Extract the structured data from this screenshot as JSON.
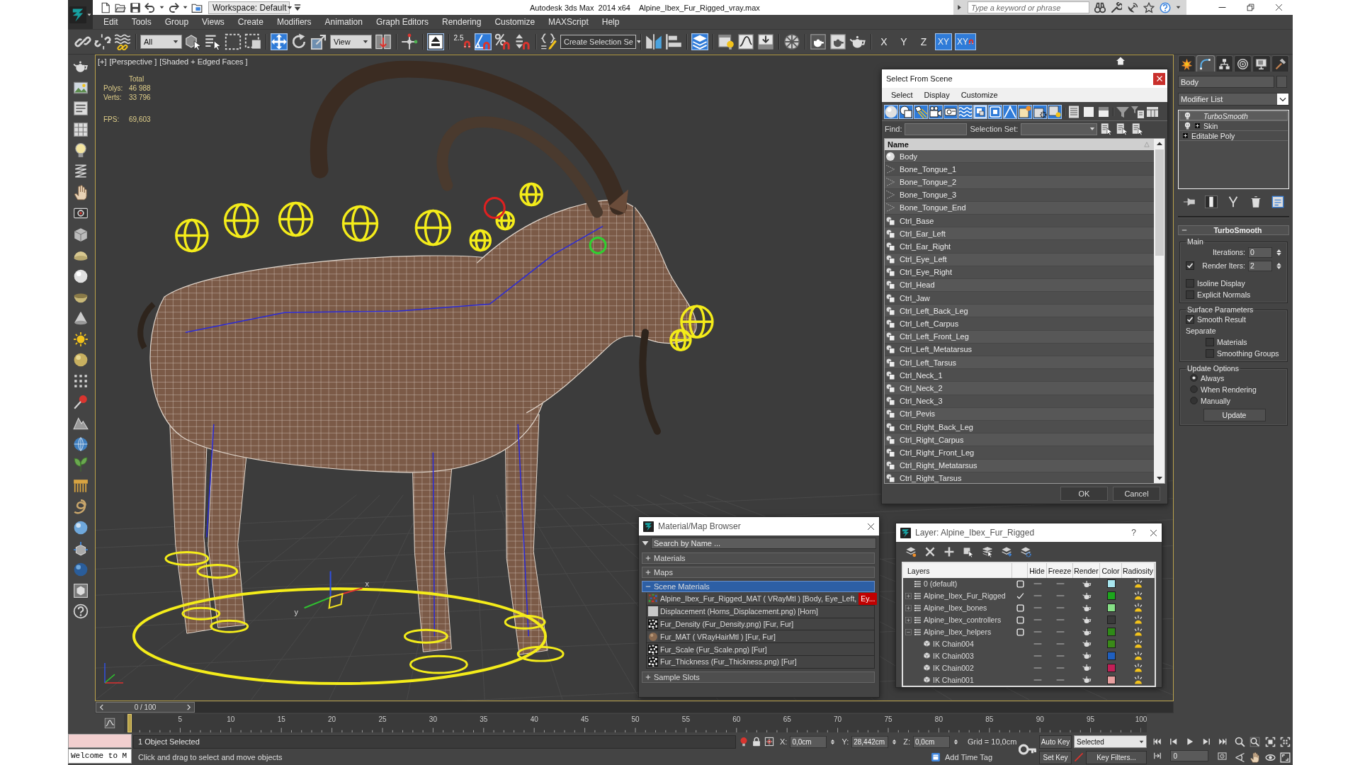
{
  "title_bar": {
    "workspace": "Workspace: Default",
    "app_name": "Autodesk 3ds Max  2014 x64",
    "file_name": "Alpine_Ibex_Fur_Rigged_vray.max",
    "search": {
      "placeholder": "Type a keyword or phrase"
    }
  },
  "menu": [
    "Edit",
    "Tools",
    "Group",
    "Views",
    "Create",
    "Modifiers",
    "Animation",
    "Graph Editors",
    "Rendering",
    "Customize",
    "MAXScript",
    "Help"
  ],
  "main_toolbar": [
    [
      {
        "kind": "icon",
        "selected": false
      },
      {
        "kind": "icon",
        "selected": false
      },
      {
        "kind": "icon",
        "selected": false
      }
    ],
    [
      {
        "kind": "dropdown",
        "value": "All"
      },
      {
        "kind": "icon",
        "selected": false
      },
      {
        "kind": "icon",
        "selected": false
      },
      {
        "kind": "icon",
        "selected": false
      },
      {
        "kind": "icon",
        "selected": false
      }
    ],
    [
      {
        "kind": "icon",
        "selected": true
      },
      {
        "kind": "icon",
        "selected": false
      },
      {
        "kind": "icon",
        "selected": false
      },
      {
        "kind": "dropdown",
        "value": "View"
      },
      {
        "kind": "icon",
        "selected": false
      }
    ],
    [
      {
        "kind": "icon",
        "selected": false
      }
    ],
    [
      {
        "kind": "icon",
        "selected": true
      }
    ],
    [
      {
        "kind": "snap",
        "label": "2.5",
        "selected": false
      },
      {
        "kind": "icon",
        "selected": true
      },
      {
        "kind": "icon",
        "selected": false
      },
      {
        "kind": "icon",
        "selected": false
      }
    ],
    [
      {
        "kind": "icon",
        "selected": false
      },
      {
        "kind": "combo",
        "value": "Create Selection Se"
      }
    ],
    [
      {
        "kind": "icon",
        "selected": false
      },
      {
        "kind": "icon",
        "selected": false
      }
    ],
    [
      {
        "kind": "icon",
        "selected": true
      }
    ],
    [
      {
        "kind": "icon",
        "selected": false
      },
      {
        "kind": "icon",
        "selected": false
      },
      {
        "kind": "icon",
        "selected": false
      }
    ],
    [
      {
        "kind": "icon",
        "selected": false
      }
    ],
    [
      {
        "kind": "icon",
        "selected": false
      },
      {
        "kind": "icon",
        "selected": false
      },
      {
        "kind": "icon",
        "selected": false
      }
    ],
    [
      {
        "kind": "axis",
        "label": "X",
        "selected": false
      },
      {
        "kind": "axis",
        "label": "Y",
        "selected": false
      },
      {
        "kind": "axis",
        "label": "Z",
        "selected": false
      },
      {
        "kind": "axis",
        "label": "XY",
        "selected": true
      },
      {
        "kind": "axis_snap",
        "label": "XY",
        "selected": true
      }
    ]
  ],
  "viewport": {
    "labels": [
      "[+]",
      "[Perspective ]",
      "[Shaded + Edged Faces ]"
    ],
    "stats": {
      "heading": "Total",
      "rows": [
        {
          "label": "Polys:",
          "value": "46 988"
        },
        {
          "label": "Verts:",
          "value": "33 796"
        }
      ],
      "fps": {
        "label": "FPS:",
        "value": "69,603"
      }
    },
    "gizmo_labels": [
      "x",
      "y"
    ]
  },
  "select_from_scene": {
    "title": "Select From Scene",
    "menu": [
      "Select",
      "Display",
      "Customize"
    ],
    "filters": [
      {
        "selected": true
      },
      {
        "selected": true
      },
      {
        "selected": true
      },
      {
        "selected": true
      },
      {
        "selected": true
      },
      {
        "selected": true
      },
      {
        "selected": true
      },
      {
        "selected": true
      },
      {
        "selected": true
      },
      {
        "selected": true
      },
      {
        "selected": true
      },
      {
        "selected": true
      }
    ],
    "find": {
      "label": "Find:"
    },
    "selection_set": {
      "label": "Selection Set:"
    },
    "column": "Name",
    "rows": [
      {
        "name": "Body",
        "kind": "geometry"
      },
      {
        "name": "Bone_Tongue_1",
        "kind": "bone"
      },
      {
        "name": "Bone_Tongue_2",
        "kind": "bone"
      },
      {
        "name": "Bone_Tongue_3",
        "kind": "bone"
      },
      {
        "name": "Bone_Tongue_End",
        "kind": "bone"
      },
      {
        "name": "Ctrl_Base",
        "kind": "helper"
      },
      {
        "name": "Ctrl_Ear_Left",
        "kind": "helper"
      },
      {
        "name": "Ctrl_Ear_Right",
        "kind": "helper"
      },
      {
        "name": "Ctrl_Eye_Left",
        "kind": "helper"
      },
      {
        "name": "Ctrl_Eye_Right",
        "kind": "helper"
      },
      {
        "name": "Ctrl_Head",
        "kind": "helper"
      },
      {
        "name": "Ctrl_Jaw",
        "kind": "helper"
      },
      {
        "name": "Ctrl_Left_Back_Leg",
        "kind": "helper"
      },
      {
        "name": "Ctrl_Left_Carpus",
        "kind": "helper"
      },
      {
        "name": "Ctrl_Left_Front_Leg",
        "kind": "helper"
      },
      {
        "name": "Ctrl_Left_Metatarsus",
        "kind": "helper"
      },
      {
        "name": "Ctrl_Left_Tarsus",
        "kind": "helper"
      },
      {
        "name": "Ctrl_Neck_1",
        "kind": "helper"
      },
      {
        "name": "Ctrl_Neck_2",
        "kind": "helper"
      },
      {
        "name": "Ctrl_Neck_3",
        "kind": "helper"
      },
      {
        "name": "Ctrl_Pevis",
        "kind": "helper"
      },
      {
        "name": "Ctrl_Right_Back_Leg",
        "kind": "helper"
      },
      {
        "name": "Ctrl_Right_Carpus",
        "kind": "helper"
      },
      {
        "name": "Ctrl_Right_Front_Leg",
        "kind": "helper"
      },
      {
        "name": "Ctrl_Right_Metatarsus",
        "kind": "helper"
      },
      {
        "name": "Ctrl_Right_Tarsus",
        "kind": "helper"
      }
    ],
    "buttons": [
      "OK",
      "Cancel"
    ]
  },
  "material_browser": {
    "title": "Material/Map Browser",
    "search": {
      "placeholder": "Search by Name ..."
    },
    "groups": [
      {
        "label": "Materials",
        "expanded": false,
        "selected": false
      },
      {
        "label": "Maps",
        "expanded": false,
        "selected": false
      },
      {
        "label": "Scene Materials",
        "expanded": true,
        "selected": true,
        "items": [
          {
            "kind": "vray_material",
            "label": "Alpine_Ibex_Fur_Rigged_MAT ( VRayMtl ) [Body, Eye_Left,",
            "overflow": "Ey..."
          },
          {
            "kind": "grey_map",
            "label": "Displacement (Horns_Displacement.png) [Horn]"
          },
          {
            "kind": "noise_map",
            "label": "Fur_Density (Fur_Density.png) [Fur, Fur]"
          },
          {
            "kind": "hair_material",
            "label": "Fur_MAT ( VRayHairMtl ) [Fur, Fur]"
          },
          {
            "kind": "noise_map",
            "label": "Fur_Scale (Fur_Scale.png) [Fur]"
          },
          {
            "kind": "noise_map",
            "label": "Fur_Thickness (Fur_Thickness.png) [Fur]"
          }
        ]
      },
      {
        "label": "Sample Slots",
        "expanded": false,
        "selected": false
      }
    ]
  },
  "layer_dialog": {
    "title": "Layer: Alpine_Ibex_Fur_Rigged",
    "help": "?",
    "columns": [
      "Layers",
      "Hide",
      "Freeze",
      "Render",
      "Color",
      "Radiosity"
    ],
    "layers": [
      {
        "name": "0 (default)",
        "expandable": false,
        "expanded": false,
        "current": false,
        "hidden": false,
        "frozen": false,
        "renderable": true,
        "radiosity": true,
        "color": "#a8e6ef"
      },
      {
        "name": "Alpine_Ibex_Fur_Rigged",
        "expandable": true,
        "expanded": false,
        "current": true,
        "hidden": false,
        "frozen": false,
        "renderable": true,
        "radiosity": true,
        "color": "#1da61d"
      },
      {
        "name": "Alpine_Ibex_bones",
        "expandable": true,
        "expanded": false,
        "current": false,
        "hidden": false,
        "frozen": false,
        "renderable": true,
        "radiosity": true,
        "color": "#86e086"
      },
      {
        "name": "Alpine_Ibex_controllers",
        "expandable": true,
        "expanded": false,
        "current": false,
        "hidden": false,
        "frozen": false,
        "renderable": true,
        "radiosity": true,
        "color": "#3a3a3a"
      },
      {
        "name": "Alpine_Ibex_helpers",
        "expandable": true,
        "expanded": true,
        "current": false,
        "hidden": false,
        "frozen": false,
        "renderable": true,
        "radiosity": true,
        "color": "#2f8a17",
        "children": [
          {
            "name": "IK Chain004",
            "hidden": false,
            "frozen": false,
            "renderable": true,
            "radiosity": true,
            "color": "#3a8a18"
          },
          {
            "name": "IK Chain003",
            "hidden": false,
            "frozen": false,
            "renderable": true,
            "radiosity": true,
            "color": "#1f5fbf"
          },
          {
            "name": "IK Chain002",
            "hidden": false,
            "frozen": false,
            "renderable": true,
            "radiosity": true,
            "color": "#c21f57"
          },
          {
            "name": "IK Chain001",
            "hidden": false,
            "frozen": false,
            "renderable": true,
            "radiosity": true,
            "color": "#e8a0a0"
          }
        ]
      }
    ]
  },
  "command_panel": {
    "tabs": [
      {
        "selected": false
      },
      {
        "selected": true
      },
      {
        "selected": false
      },
      {
        "selected": false
      },
      {
        "selected": false
      },
      {
        "selected": false
      }
    ],
    "object_name": "Body",
    "modifier_list": "Modifier List",
    "stack": [
      {
        "label": "TurboSmooth",
        "kind": "modifier",
        "expandable": false,
        "viewport_off": true,
        "selected": true
      },
      {
        "label": "Skin",
        "kind": "modifier",
        "expandable": true,
        "viewport_off": false,
        "selected": false
      },
      {
        "label": "Editable Poly",
        "kind": "object",
        "expandable": true,
        "viewport_off": false,
        "selected": false
      }
    ],
    "stack_tools": [
      {
        "selected": false
      },
      {
        "selected": true
      },
      {
        "selected": false
      },
      {
        "selected": false
      },
      {
        "selected": false
      }
    ],
    "rollout": {
      "title": "TurboSmooth",
      "expanded": true,
      "groups": [
        {
          "title": "Main",
          "controls": [
            {
              "kind": "spinner",
              "label": "Iterations:",
              "value": "0"
            },
            {
              "kind": "check_spinner",
              "label": "Render Iters:",
              "value": "2",
              "checked": true
            },
            {
              "kind": "checkbox",
              "label": "Isoline Display",
              "checked": false
            },
            {
              "kind": "checkbox",
              "label": "Explicit Normals",
              "checked": false
            }
          ]
        },
        {
          "title": "Surface Parameters",
          "controls": [
            {
              "kind": "checkbox",
              "label": "Smooth Result",
              "checked": true
            },
            {
              "kind": "label",
              "label": "Separate",
              "children": [
                {
                  "kind": "checkbox",
                  "label": "Materials",
                  "checked": false
                },
                {
                  "kind": "checkbox",
                  "label": "Smoothing Groups",
                  "checked": false
                }
              ]
            }
          ]
        },
        {
          "title": "Update Options",
          "controls": [
            {
              "kind": "radio",
              "label": "Always",
              "selected": true
            },
            {
              "kind": "radio",
              "label": "When Rendering",
              "selected": false
            },
            {
              "kind": "radio",
              "label": "Manually",
              "selected": false
            },
            {
              "kind": "button",
              "label": "Update"
            }
          ]
        }
      ]
    }
  },
  "time_slider": {
    "position": "0 / 100",
    "level": 0
  },
  "track_bar": {
    "labels": [
      "5",
      "10",
      "15",
      "20",
      "25",
      "30",
      "35",
      "40",
      "45",
      "50",
      "55",
      "60",
      "65",
      "70",
      "75",
      "80",
      "85",
      "90",
      "95",
      "100"
    ]
  },
  "status_bar": {
    "listener": "Welcome to M",
    "selection": "1 Object Selected",
    "prompt": "Click and drag to select and move objects",
    "coords": [
      {
        "axis": "X:",
        "value": "0,0cm"
      },
      {
        "axis": "Y:",
        "value": "28,442cm"
      },
      {
        "axis": "Z:",
        "value": "0,0cm"
      }
    ],
    "grid": "Grid = 10,0cm",
    "time_tag": "Add Time Tag",
    "auto_key": {
      "label": "Auto Key",
      "selected": false
    },
    "set_key": "Set Key",
    "key_mode": "Selected",
    "key_filters": "Key Filters...",
    "frame": "0"
  }
}
